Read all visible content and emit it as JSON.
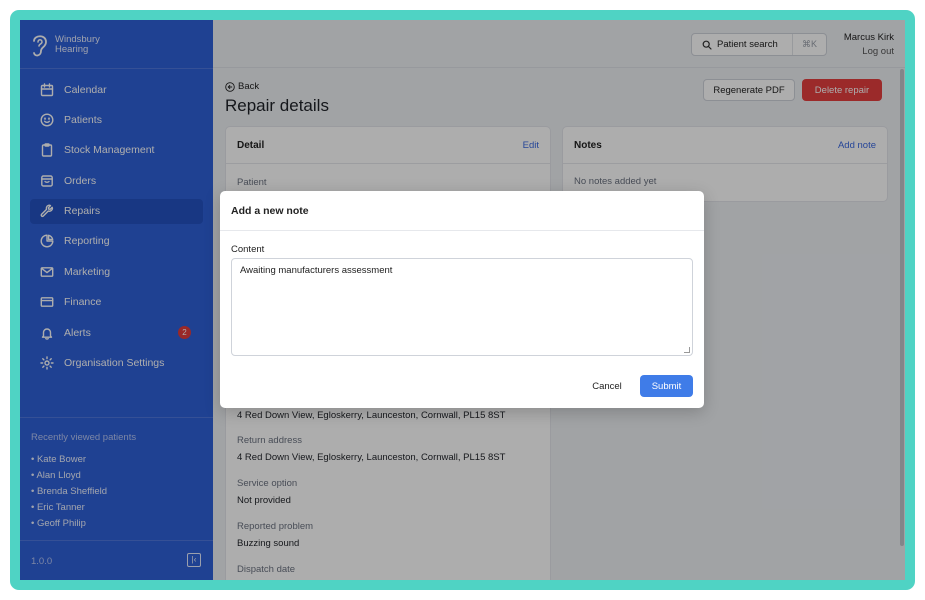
{
  "brand": {
    "line1": "Windsbury",
    "line2": "Hearing",
    "logo_icon": "ear-icon"
  },
  "nav": [
    {
      "label": "Calendar",
      "icon": "calendar-icon",
      "active": false
    },
    {
      "label": "Patients",
      "icon": "smile-icon",
      "active": false
    },
    {
      "label": "Stock Management",
      "icon": "clipboard-icon",
      "active": false
    },
    {
      "label": "Orders",
      "icon": "box-icon",
      "active": false
    },
    {
      "label": "Repairs",
      "icon": "wrench-icon",
      "active": true
    },
    {
      "label": "Reporting",
      "icon": "pie-chart-icon",
      "active": false
    },
    {
      "label": "Marketing",
      "icon": "mail-icon",
      "active": false
    },
    {
      "label": "Finance",
      "icon": "credit-card-icon",
      "active": false
    },
    {
      "label": "Alerts",
      "icon": "bell-icon",
      "active": false,
      "badge": "2"
    },
    {
      "label": "Organisation Settings",
      "icon": "gear-icon",
      "active": false
    }
  ],
  "recent": {
    "title": "Recently viewed patients",
    "items": [
      "• Kate Bower",
      "• Alan Lloyd",
      "• Brenda Sheffield",
      "• Eric Tanner",
      "• Geoff Philip"
    ]
  },
  "version": "1.0.0",
  "topbar": {
    "search_label": "Patient search",
    "shortcut": "⌘K",
    "user_name": "Marcus Kirk",
    "logout": "Log out"
  },
  "page": {
    "back": "Back",
    "title": "Repair details",
    "regenerate": "Regenerate PDF",
    "delete": "Delete repair"
  },
  "detail": {
    "title": "Detail",
    "edit": "Edit",
    "patient_label": "Patient",
    "address_value": "4 Red Down View, Egloskerry, Launceston, Cornwall, PL15 8ST",
    "return_label": "Return address",
    "return_value": "4 Red Down View, Egloskerry, Launceston, Cornwall, PL15 8ST",
    "service_label": "Service option",
    "service_value": "Not provided",
    "problem_label": "Reported problem",
    "problem_value": "Buzzing sound",
    "dispatch_label": "Dispatch date"
  },
  "notes": {
    "title": "Notes",
    "add": "Add note",
    "empty": "No notes added yet"
  },
  "modal": {
    "title": "Add a new note",
    "content_label": "Content",
    "content_value": "Awaiting manufacturers assessment",
    "cancel": "Cancel",
    "submit": "Submit"
  },
  "colors": {
    "sidebar": "#2f60d8",
    "accent": "#3f7ce8",
    "danger": "#e53e3e",
    "frame": "#4fd3c4"
  }
}
